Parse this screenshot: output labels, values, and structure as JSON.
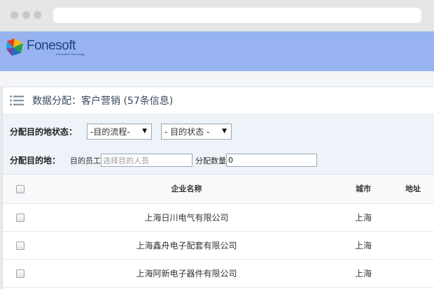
{
  "brand": {
    "name": "Fonesoft",
    "tagline": "Information Technology",
    "colors": {
      "header": "#98b4f0",
      "logo_text": "#1f3f86"
    }
  },
  "page": {
    "title": "数据分配：客户营销 (57条信息)"
  },
  "filters": {
    "status_label": "分配目的地状态：",
    "flow_select": "-目的流程-",
    "state_select": "- 目的状态 -",
    "dest_label": "分配目的地：",
    "staff_label": "目的员工",
    "staff_placeholder": "选择目的人员",
    "count_label": "分配数量",
    "count_value": "0"
  },
  "table": {
    "columns": [
      "企业名称",
      "城市",
      "地址"
    ],
    "rows": [
      {
        "company": "上海日川电气有限公司",
        "city": "上海",
        "address": ""
      },
      {
        "company": "上海鑫舟电子配套有限公司",
        "city": "上海",
        "address": ""
      },
      {
        "company": "上海阿新电子器件有限公司",
        "city": "上海",
        "address": ""
      }
    ]
  }
}
